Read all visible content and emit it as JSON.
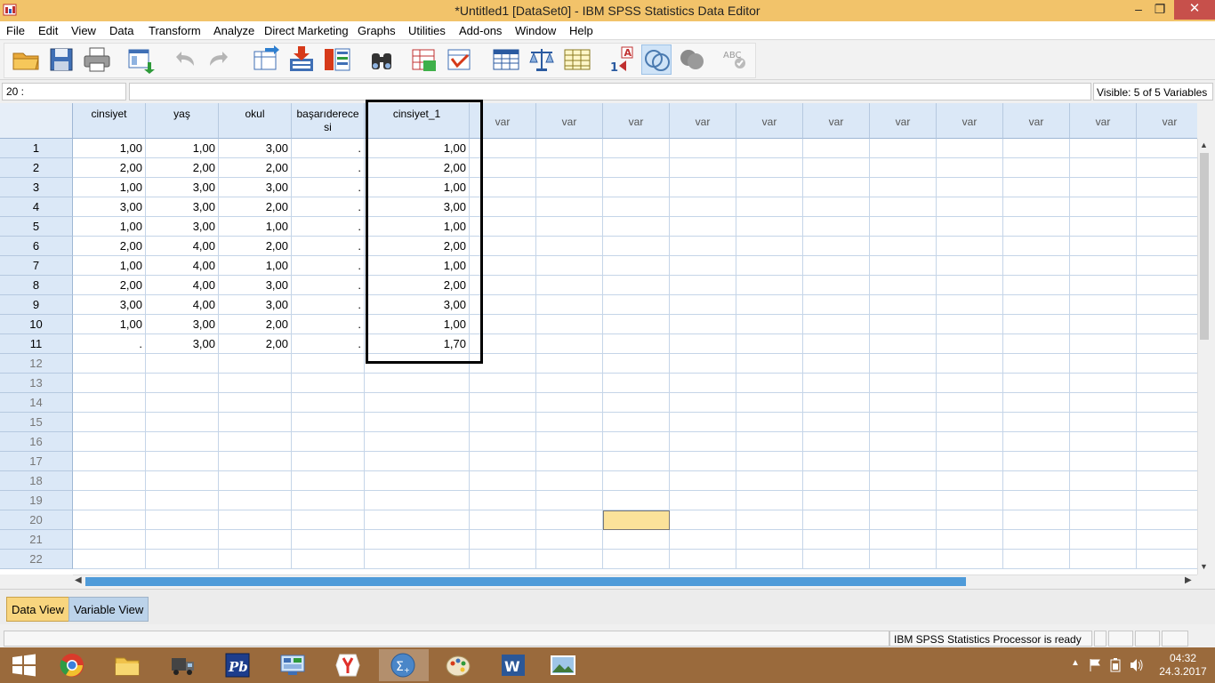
{
  "window": {
    "title": "*Untitled1 [DataSet0] - IBM SPSS Statistics Data Editor",
    "min_glyph": "–",
    "max_glyph": "❐",
    "close_glyph": "✕"
  },
  "menu": [
    "File",
    "Edit",
    "View",
    "Data",
    "Transform",
    "Analyze",
    "Direct Marketing",
    "Graphs",
    "Utilities",
    "Add-ons",
    "Window",
    "Help"
  ],
  "toolbar_icons": [
    "open-folder-icon",
    "save-icon",
    "print-icon",
    "dialog-recall-icon",
    "undo-icon",
    "redo-icon",
    "go-to-case-icon",
    "go-to-variable-icon",
    "variables-icon",
    "find-icon",
    "insert-cases-icon",
    "insert-variable-icon",
    "split-file-icon",
    "weight-cases-icon",
    "select-cases-icon",
    "value-labels-icon",
    "use-variable-sets-icon",
    "show-all-variables-icon",
    "spell-check-icon"
  ],
  "ref_bar": {
    "cell_ref": "20 :",
    "cell_value": "",
    "visible_vars": "Visible: 5 of 5 Variables"
  },
  "grid": {
    "columns": [
      "cinsiyet",
      "yaş",
      "okul",
      "başarıderece si",
      "cinsiyet_1"
    ],
    "var_placeholder": "var",
    "var_column_count": 11,
    "rows": [
      [
        "1,00",
        "1,00",
        "3,00",
        ".",
        "1,00"
      ],
      [
        "2,00",
        "2,00",
        "2,00",
        ".",
        "2,00"
      ],
      [
        "1,00",
        "3,00",
        "3,00",
        ".",
        "1,00"
      ],
      [
        "3,00",
        "3,00",
        "2,00",
        ".",
        "3,00"
      ],
      [
        "1,00",
        "3,00",
        "1,00",
        ".",
        "1,00"
      ],
      [
        "2,00",
        "4,00",
        "2,00",
        ".",
        "2,00"
      ],
      [
        "1,00",
        "4,00",
        "1,00",
        ".",
        "1,00"
      ],
      [
        "2,00",
        "4,00",
        "3,00",
        ".",
        "2,00"
      ],
      [
        "3,00",
        "4,00",
        "3,00",
        ".",
        "3,00"
      ],
      [
        "1,00",
        "3,00",
        "2,00",
        ".",
        "1,00"
      ],
      [
        ".",
        "3,00",
        "2,00",
        ".",
        "1,70"
      ]
    ],
    "row_labels": [
      "1",
      "2",
      "3",
      "4",
      "5",
      "6",
      "7",
      "8",
      "9",
      "10",
      "11",
      "12",
      "13",
      "14",
      "15",
      "16",
      "17",
      "18",
      "19",
      "20",
      "21",
      "22"
    ],
    "selected_row": 20,
    "selected_var_col": 3
  },
  "tabs": {
    "data_view": "Data View",
    "variable_view": "Variable View"
  },
  "status": {
    "processor": "IBM SPSS Statistics Processor is ready"
  },
  "taskbar": {
    "apps": [
      "start-icon",
      "chrome-icon",
      "file-explorer-icon",
      "truck-game-icon",
      "pb-app-icon",
      "control-panel-icon",
      "yandex-icon",
      "spss-icon",
      "paint-icon",
      "word-icon",
      "photos-icon"
    ],
    "time": "04:32",
    "date": "24.3.2017"
  },
  "colors": {
    "title_bar": "#f2c36a",
    "header_fill": "#dbe8f7",
    "selected_cell": "#fbe29a",
    "taskbar": "#9a6a3c",
    "active_tab": "#f8d57e"
  }
}
